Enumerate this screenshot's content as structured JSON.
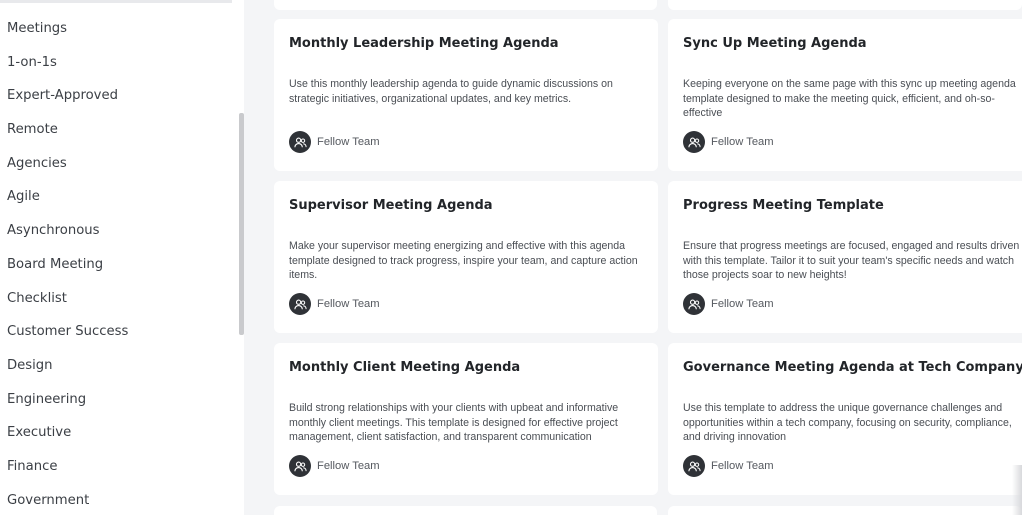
{
  "sidebar": {
    "items": [
      {
        "label": "Meetings"
      },
      {
        "label": "1-on-1s"
      },
      {
        "label": "Expert-Approved"
      },
      {
        "label": "Remote"
      },
      {
        "label": "Agencies"
      },
      {
        "label": "Agile"
      },
      {
        "label": "Asynchronous"
      },
      {
        "label": "Board Meeting"
      },
      {
        "label": "Checklist"
      },
      {
        "label": "Customer Success"
      },
      {
        "label": "Design"
      },
      {
        "label": "Engineering"
      },
      {
        "label": "Executive"
      },
      {
        "label": "Finance"
      },
      {
        "label": "Government"
      }
    ]
  },
  "cards": [
    {
      "title": "Monthly Leadership Meeting Agenda",
      "description": "Use this monthly leadership agenda to guide dynamic discussions on strategic initiatives, organizational updates, and key metrics.",
      "author": "Fellow Team"
    },
    {
      "title": "Sync Up Meeting Agenda",
      "description": "Keeping everyone on the same page with this sync up meeting agenda template designed to make the meeting quick, efficient, and oh-so-effective",
      "author": "Fellow Team"
    },
    {
      "title": "Supervisor Meeting Agenda",
      "description": "Make your supervisor meeting energizing and effective with this agenda template designed to track progress, inspire your team, and capture action items.",
      "author": "Fellow Team"
    },
    {
      "title": "Progress Meeting Template",
      "description": "Ensure that progress meetings are focused, engaged and results driven with this template. Tailor it to suit your team's specific needs and watch those projects soar to new heights!",
      "author": "Fellow Team"
    },
    {
      "title": "Monthly Client Meeting Agenda",
      "description": "Build strong relationships with your clients with upbeat and informative monthly client meetings. This template is designed for effective project management, client satisfaction, and transparent communication",
      "author": "Fellow Team"
    },
    {
      "title": "Governance Meeting Agenda at Tech Company",
      "description": "Use this template to address the unique governance challenges and opportunities within a tech company, focusing on security, compliance, and driving innovation",
      "author": "Fellow Team"
    }
  ],
  "icons": {
    "team": "team-users-icon"
  },
  "colors": {
    "background": "#f4f5f7",
    "card": "#ffffff",
    "avatar": "#2f3237"
  }
}
